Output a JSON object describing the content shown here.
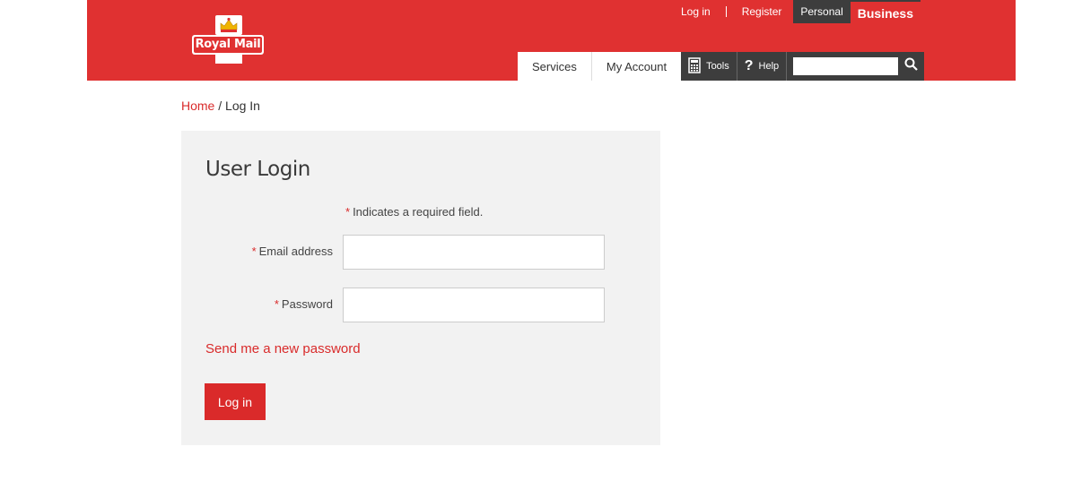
{
  "brand": {
    "logo_text": "Royal Mail",
    "primary_color": "#e03131",
    "dark_color": "#3d3d3d"
  },
  "top_links": {
    "login": "Log in",
    "register": "Register",
    "personal": "Personal",
    "business": "Business"
  },
  "main_nav": {
    "services": "Services",
    "my_account": "My Account",
    "tools": "Tools",
    "help": "Help",
    "search_placeholder": "",
    "search_value": ""
  },
  "breadcrumb": {
    "home": "Home",
    "separator": " / ",
    "current": "Log In"
  },
  "login_form": {
    "title": "User Login",
    "required_star": "*",
    "required_note": "Indicates a required field.",
    "email_label": "Email address",
    "email_value": "",
    "password_label": "Password",
    "password_value": "",
    "forgot_link": "Send me a new password",
    "submit_label": "Log in"
  }
}
